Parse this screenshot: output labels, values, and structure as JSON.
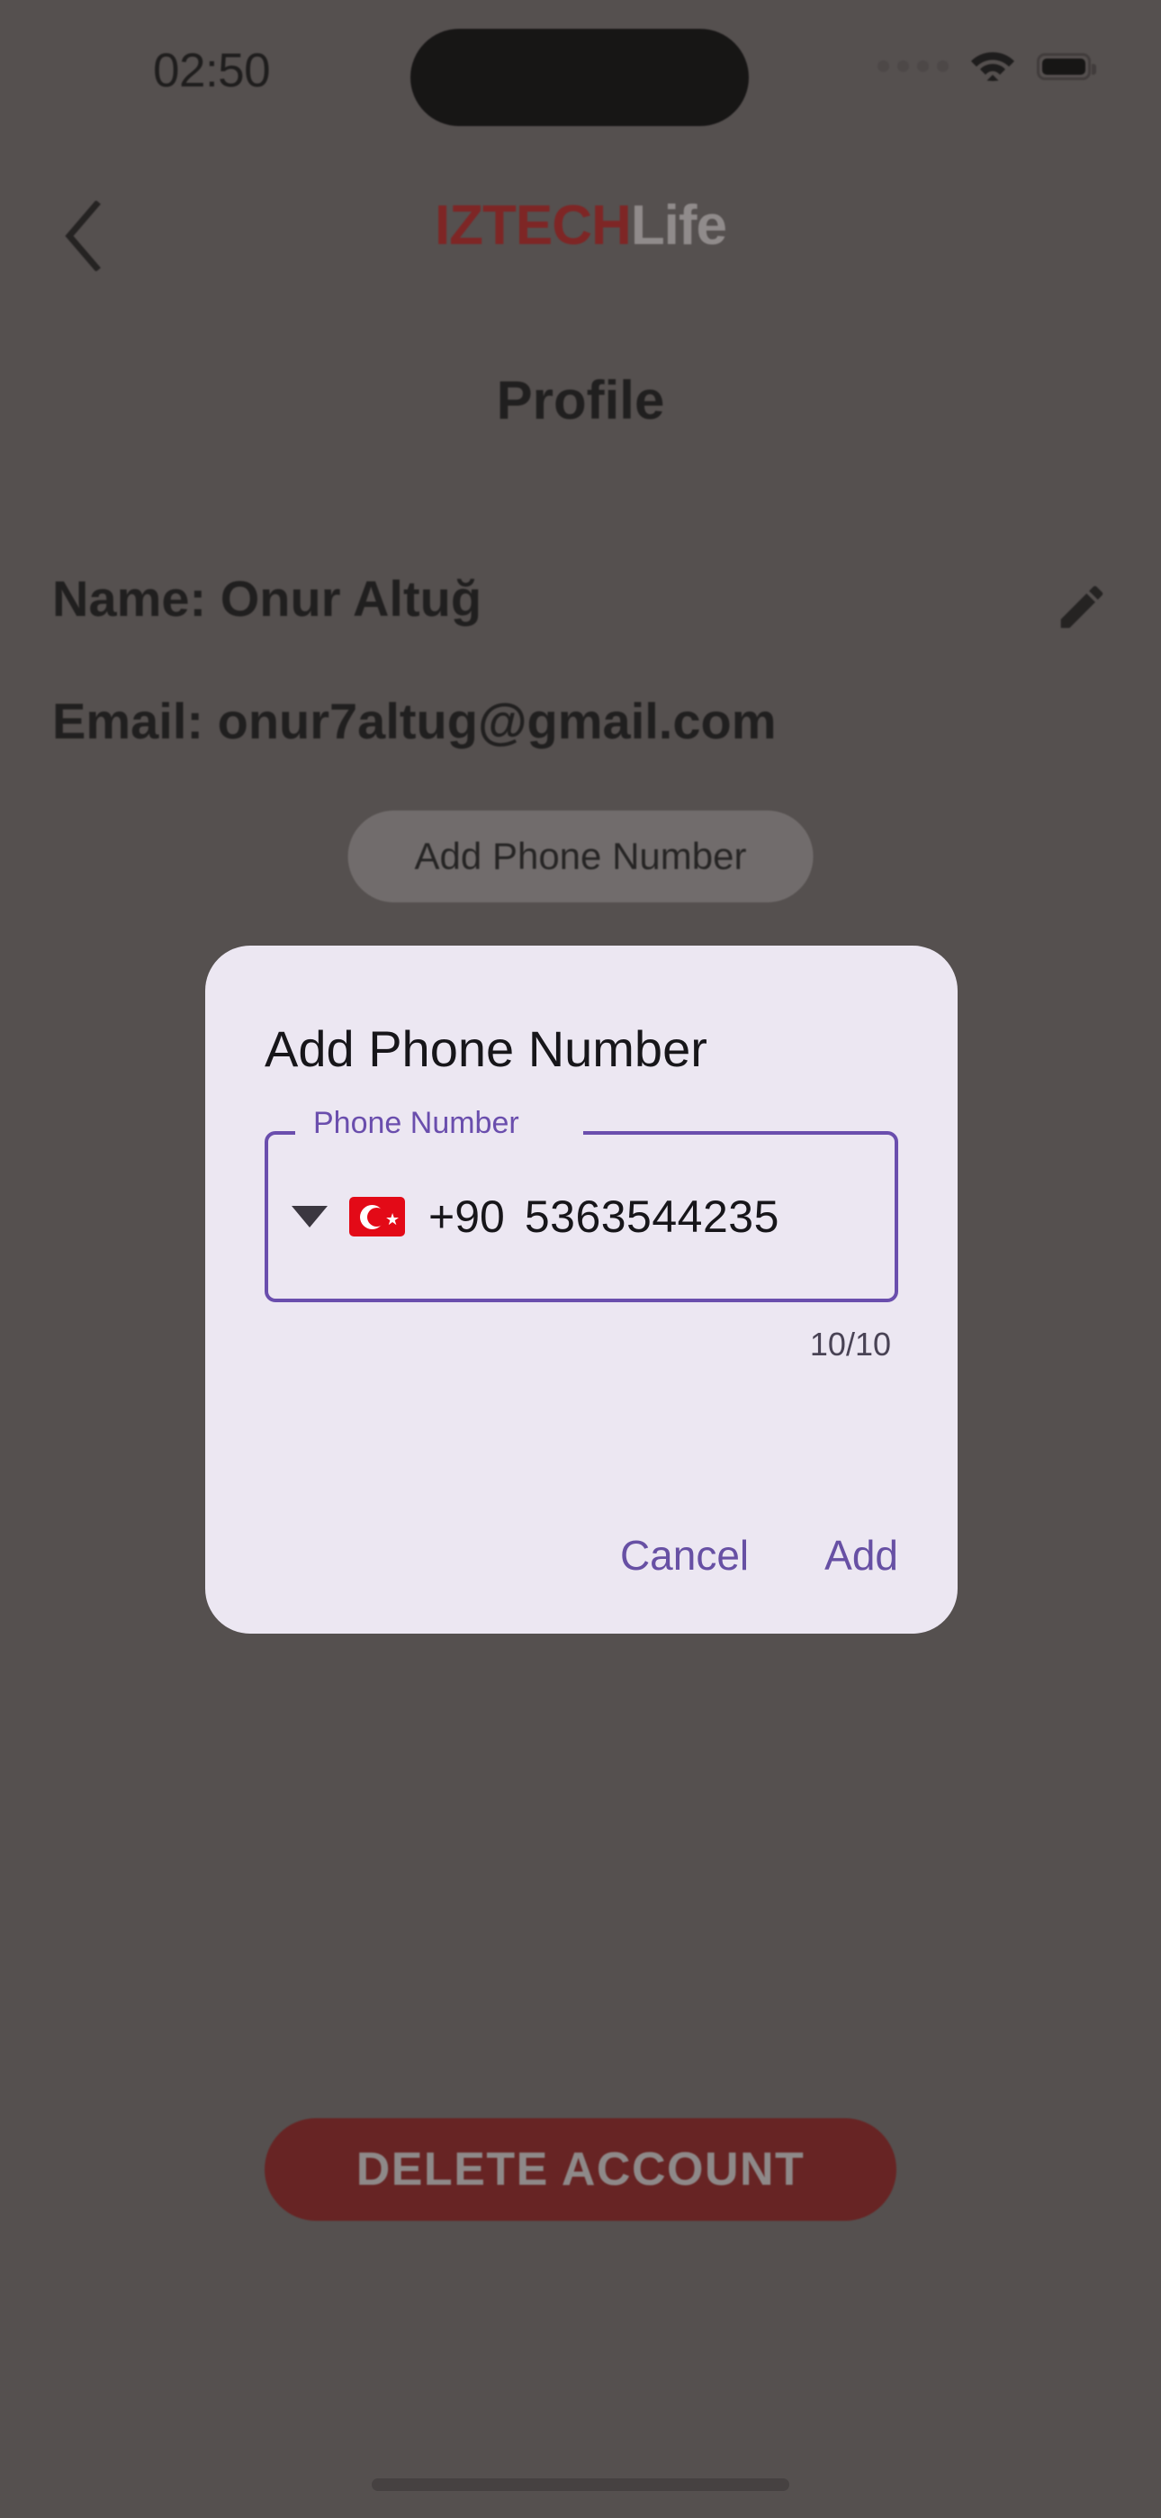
{
  "status_bar": {
    "time": "02:50",
    "signal_icon": "signal-dots-icon",
    "wifi_icon": "wifi-icon",
    "battery_icon": "battery-full-icon"
  },
  "header": {
    "back_icon": "chevron-left-icon",
    "brand_primary": "IZTECH",
    "brand_secondary": "Life",
    "brand_primary_color": "#8e1616",
    "brand_secondary_color": "#a8a3a3"
  },
  "page": {
    "title": "Profile"
  },
  "profile": {
    "name_row": "Name: Onur Altuğ",
    "email_row": "Email: onur7altug@gmail.com",
    "edit_icon": "pencil-edit-icon",
    "add_phone_label": "Add Phone Number",
    "delete_account_label": "DELETE ACCOUNT",
    "delete_account_color": "#6e1414"
  },
  "dialog": {
    "title": "Add Phone Number",
    "field_label": "Phone Number",
    "country_caret_icon": "chevron-down-icon",
    "country_flag_icon": "flag-turkey-icon",
    "country_code": "+90",
    "phone_value": "5363544235",
    "phone_placeholder": "Phone Number",
    "char_counter": "10/10",
    "cancel_label": "Cancel",
    "add_label": "Add",
    "accent_color": "#6750a4",
    "surface_color": "#ece7f2"
  }
}
